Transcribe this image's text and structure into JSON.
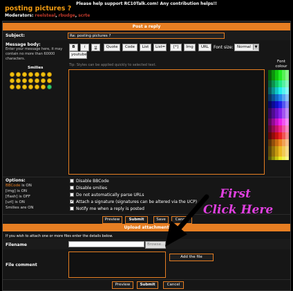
{
  "header": {
    "notice": "Please help support RC10Talk.com! Any contribution helps!!",
    "topic_title": "posting pictures ?",
    "moderators_label": "Moderators:",
    "moderators": [
      "reelsteal",
      "rbudge",
      "scrte"
    ]
  },
  "post_form": {
    "section_title": "Post a reply",
    "subject_label": "Subject:",
    "subject_value": "Re: posting pictures ?",
    "message_label": "Message body:",
    "message_help": "Enter your message here, it may contain no more than 60000 characters.",
    "smilies_label": "Smilies",
    "toolbar": [
      "B",
      "i",
      "u",
      "Quote",
      "Code",
      "List",
      "List=",
      "[*]",
      "Img",
      "URL"
    ],
    "youtube_label": "youtube",
    "font_size_label": "Font size:",
    "font_size_value": "Normal",
    "tip": "Tip: Styles can be applied quickly to selected text.",
    "font_colour_label": "Font colour",
    "message_value": ""
  },
  "options": {
    "label": "Options:",
    "status": [
      {
        "name": "BBCode",
        "state": "is ON"
      },
      {
        "name": "[img]",
        "state": "is ON"
      },
      {
        "name": "[flash]",
        "state": "is OFF"
      },
      {
        "name": "[url]",
        "state": "is ON"
      },
      {
        "name": "Smilies",
        "state": "are ON"
      }
    ],
    "checkboxes": [
      {
        "label": "Disable BBCode",
        "checked": false
      },
      {
        "label": "Disable smilies",
        "checked": false
      },
      {
        "label": "Do not automatically parse URLs",
        "checked": false
      },
      {
        "label": "Attach a signature (signatures can be altered via the UCP)",
        "checked": true
      },
      {
        "label": "Notify me when a reply is posted",
        "checked": false
      }
    ]
  },
  "actions": {
    "preview": "Preview",
    "submit": "Submit",
    "save": "Save",
    "cancel": "Cancel"
  },
  "upload": {
    "section_title": "Upload attachment",
    "help": "If you wish to attach one or more files enter the details below.",
    "filename_label": "Filename",
    "filename_value": "",
    "browse_label": "Browse...",
    "file_comment_label": "File comment",
    "add_file_label": "Add the file"
  },
  "annotation": {
    "line1": "First",
    "line2": "Click Here",
    "color": "#e040e0"
  },
  "colors": {
    "accent": "#e67e22",
    "background": "#000000"
  }
}
